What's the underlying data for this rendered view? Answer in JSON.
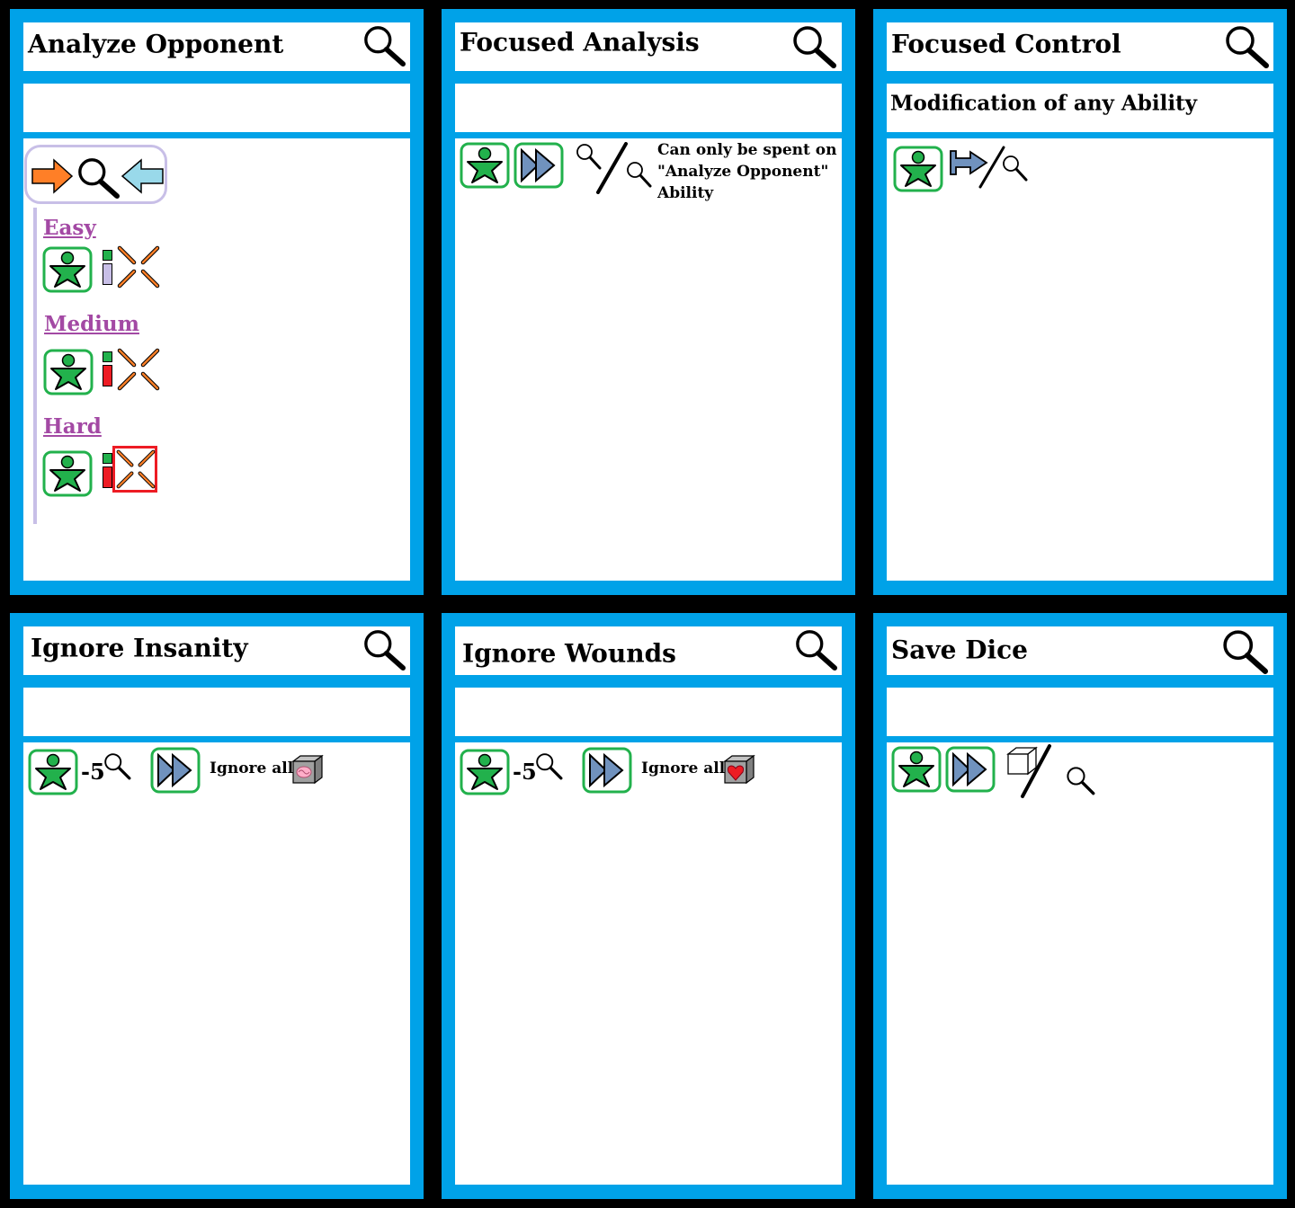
{
  "cards": [
    {
      "title": "Analyze Opponent",
      "subtitle": "",
      "levels": [
        {
          "label": "Easy"
        },
        {
          "label": "Medium"
        },
        {
          "label": "Hard"
        }
      ],
      "icons": [
        "orange-arrow-right-icon",
        "magnifier-icon",
        "blue-arrow-left-icon",
        "green-star-person-icon",
        "stat-bar-icon",
        "orange-cross-icon"
      ]
    },
    {
      "title": "Focused Analysis",
      "subtitle": "",
      "text": [
        "Can only be spent on",
        "\"Analyze Opponent\"",
        "Ability"
      ],
      "icons": [
        "green-star-person-icon",
        "fast-forward-icon",
        "magnifier-slash-magnifier-icon"
      ]
    },
    {
      "title": "Focused Control",
      "subtitle": "Modification of any Ability",
      "icons": [
        "green-star-person-icon",
        "pushpin-arrow-icon",
        "magnifier-icon"
      ]
    },
    {
      "title": "Ignore Insanity",
      "subtitle": "",
      "cost": "-5",
      "text": "Ignore all",
      "icons": [
        "green-star-person-icon",
        "magnifier-icon",
        "fast-forward-icon",
        "brain-cube-icon"
      ]
    },
    {
      "title": "Ignore Wounds",
      "subtitle": "",
      "cost": "-5",
      "text": "Ignore all",
      "icons": [
        "green-star-person-icon",
        "magnifier-icon",
        "fast-forward-icon",
        "heart-cube-icon"
      ]
    },
    {
      "title": "Save Dice",
      "subtitle": "",
      "icons": [
        "green-star-person-icon",
        "fast-forward-icon",
        "cube-icon",
        "magnifier-icon"
      ]
    }
  ],
  "colors": {
    "card_border": "#00a2e8",
    "star_green": "#22b14c",
    "level_purple": "#a349a4",
    "arrow_orange": "#ff7f27",
    "arrow_blue": "#99d9ea",
    "ff_blue": "#7092be",
    "frame_red": "#ed1c24"
  }
}
